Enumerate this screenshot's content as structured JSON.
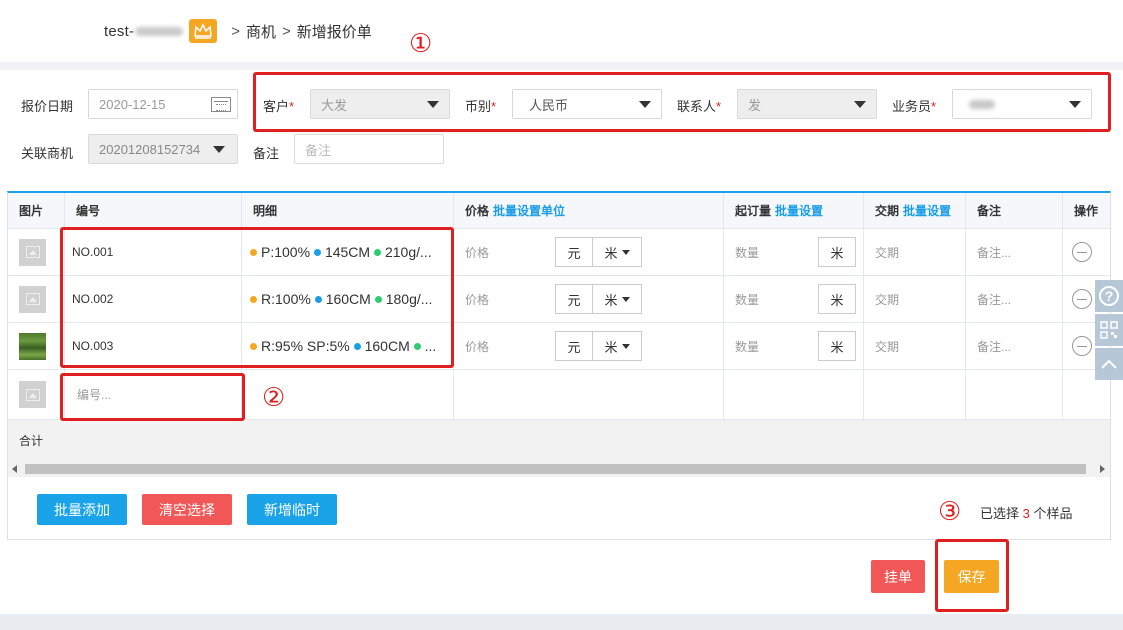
{
  "breadcrumb": {
    "user": "test-",
    "sep1": ">",
    "crumb1": "商机",
    "sep2": ">",
    "crumb2": "新增报价单"
  },
  "annotations": {
    "n1": "①",
    "n2": "②",
    "n3": "③"
  },
  "form": {
    "date_label": "报价日期",
    "date_value": "2020-12-15",
    "customer_label": "客户",
    "customer_value": "大发",
    "currency_label": "币别",
    "currency_value": "人民币",
    "contact_label": "联系人",
    "contact_value": "发",
    "salesman_label": "业务员",
    "related_label": "关联商机",
    "related_value": "20201208152734",
    "note_label": "备注",
    "note_placeholder": "备注",
    "required_mark": "*"
  },
  "table": {
    "headers": {
      "image": "图片",
      "code": "编号",
      "detail": "明细",
      "price": "价格",
      "price_link": "批量设置单位",
      "moq": "起订量",
      "moq_link": "批量设置",
      "lead": "交期",
      "lead_link": "批量设置",
      "note": "备注",
      "action": "操作"
    },
    "rows": [
      {
        "code": "NO.001",
        "spec": [
          "P:100%",
          "145CM",
          "210g/..."
        ],
        "price_placeholder": "价格",
        "currency": "元",
        "unit": "米",
        "qty_placeholder": "数量",
        "qty_unit": "米",
        "lead_placeholder": "交期",
        "note_placeholder": "备注..."
      },
      {
        "code": "NO.002",
        "spec": [
          "R:100%",
          "160CM",
          "180g/..."
        ],
        "price_placeholder": "价格",
        "currency": "元",
        "unit": "米",
        "qty_placeholder": "数量",
        "qty_unit": "米",
        "lead_placeholder": "交期",
        "note_placeholder": "备注..."
      },
      {
        "code": "NO.003",
        "spec": [
          "R:95% SP:5%",
          "160CM",
          "..."
        ],
        "price_placeholder": "价格",
        "currency": "元",
        "unit": "米",
        "qty_placeholder": "数量",
        "qty_unit": "米",
        "lead_placeholder": "交期",
        "note_placeholder": "备注..."
      }
    ],
    "new_code_placeholder": "编号...",
    "total_label": "合计"
  },
  "dot_colors": {
    "c1": "#f5a623",
    "c2": "#1a9ee6",
    "c3": "#2ecc71"
  },
  "buttons": {
    "batch_add": "批量添加",
    "clear": "清空选择",
    "add_temp": "新增临时",
    "hold": "挂单",
    "save": "保存"
  },
  "selection": {
    "prefix": "已选择",
    "count": "3",
    "suffix": "个样品"
  },
  "side_tools": {
    "help": "?"
  }
}
